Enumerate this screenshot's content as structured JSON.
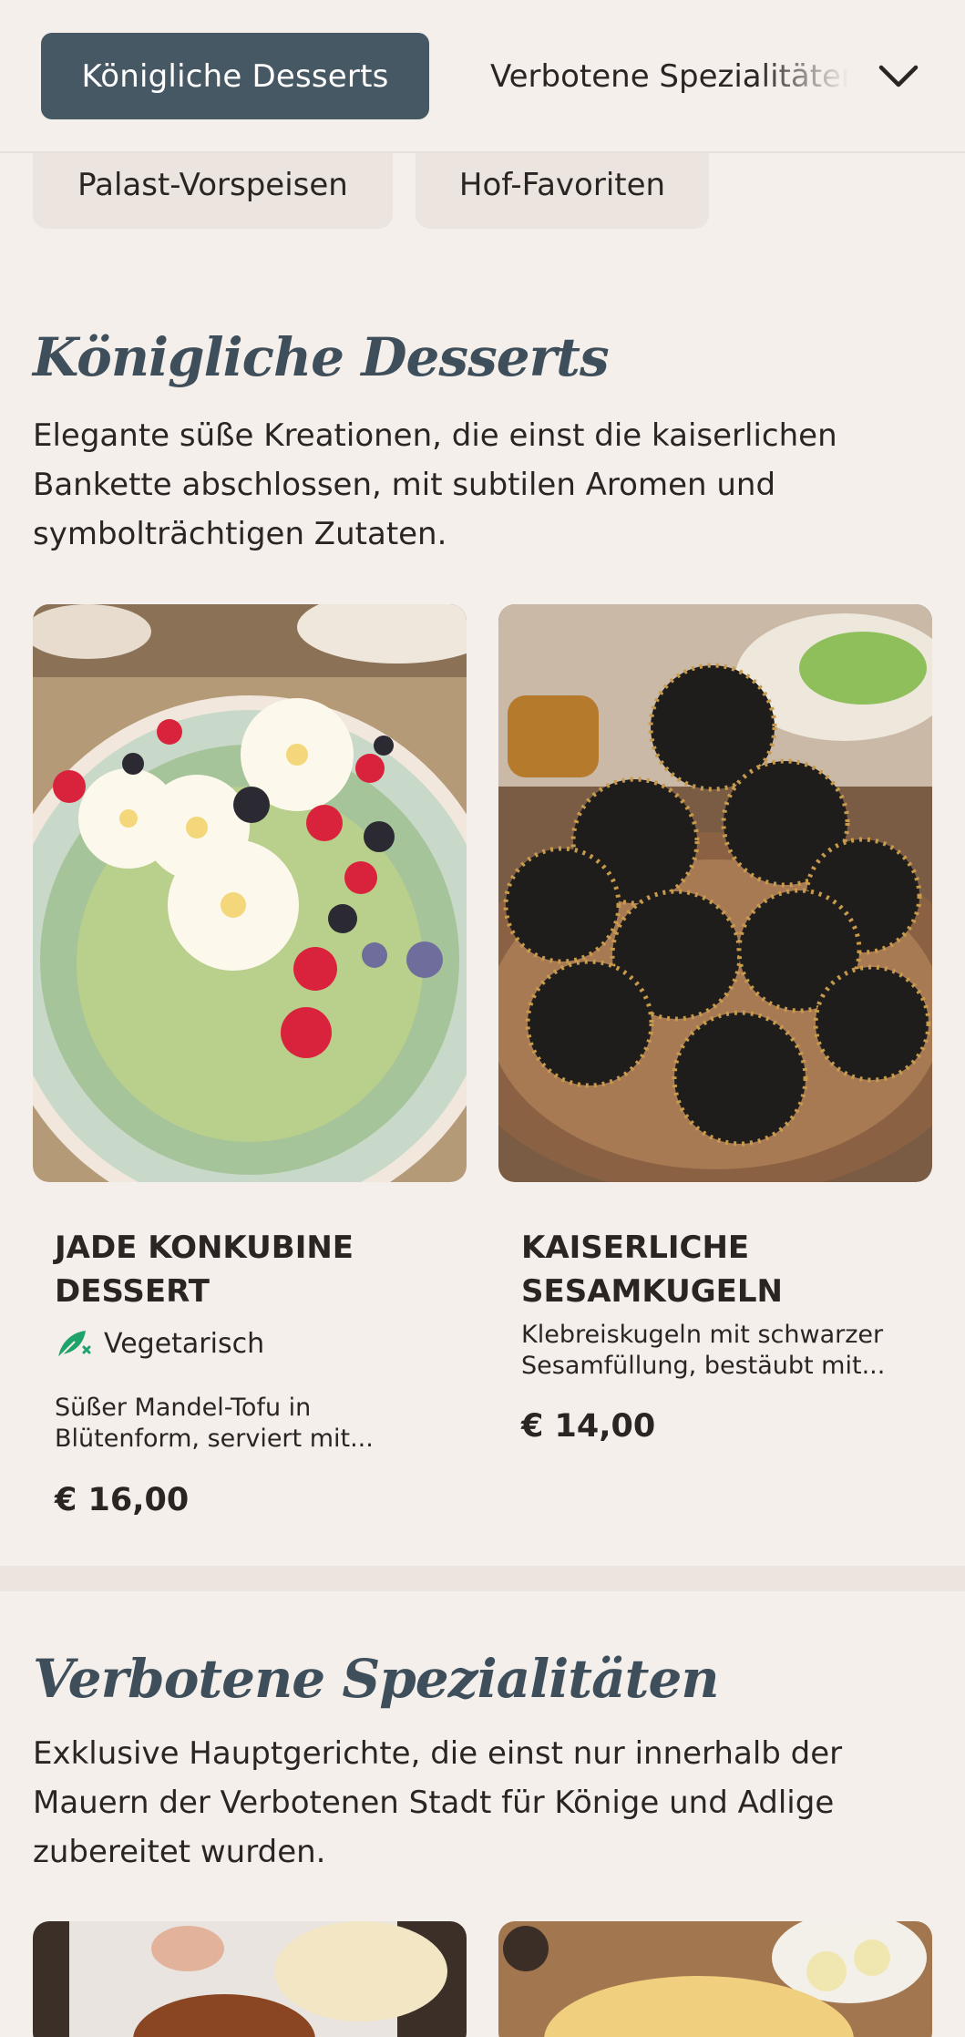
{
  "tabs": {
    "active_label": "Königliche Desserts",
    "next_label": "Verbotene Spezialitäten",
    "chips": [
      "Palast-Vorspeisen",
      "Hof-Favoriten"
    ]
  },
  "sections": [
    {
      "title": "Königliche Desserts",
      "description": "Elegante süße Kreationen, die einst die kaiserlichen Bankette abschlossen, mit subtilen Aromen und symbolträchtigen Zutaten.",
      "items": [
        {
          "title_line1": "JADE KONKUBINE",
          "title_line2": "DESSERT",
          "badge": "Vegetarisch",
          "text_line1": "Süßer Mandel-Tofu in",
          "text_line2": "Blütenform, serviert mit...",
          "price": "€ 16,00"
        },
        {
          "title_line1": "KAISERLICHE",
          "title_line2": "SESAMKUGELN",
          "text_line1": "Klebreiskugeln mit schwarzer",
          "text_line2": "Sesamfüllung, bestäubt mit...",
          "price": "€ 14,00"
        }
      ]
    },
    {
      "title": "Verbotene Spezialitäten",
      "description": "Exklusive Hauptgerichte, die einst nur innerhalb der Mauern der Verbotenen Stadt für Könige und Adlige zubereitet wurden."
    }
  ],
  "colors": {
    "accent": "#475865",
    "heading": "#3e4f5b",
    "background": "#f4efeb",
    "veg_icon": "#1fa36a"
  },
  "icons": {
    "dropdown": "chevron-down-icon",
    "vegetarian": "leaf-icon"
  }
}
